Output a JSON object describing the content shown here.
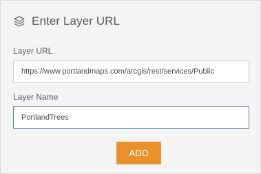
{
  "header": {
    "title": "Enter Layer URL",
    "icon": "layers-icon"
  },
  "form": {
    "layer_url": {
      "label": "Layer URL",
      "value": "https://www.portlandmaps.com/arcgis/rest/services/Public"
    },
    "layer_name": {
      "label": "Layer Name",
      "value": "PortlandTrees"
    },
    "add_label": "ADD"
  },
  "colors": {
    "accent_button": "#e8912d",
    "focus_border": "#5b7ba8",
    "panel_background": "#f4f4f4"
  }
}
